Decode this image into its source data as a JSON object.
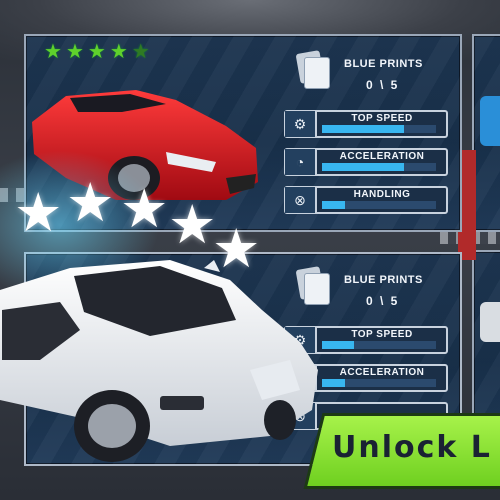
{
  "card_top": {
    "stars_filled": 4,
    "stars_total": 5,
    "blueprints_label": "BLUE PRINTS",
    "blueprints_count": "0 \\ 5",
    "stats": [
      {
        "label": "TOP SPEED",
        "icon": "gear-shift-icon",
        "level": 0.72
      },
      {
        "label": "ACCELERATION",
        "icon": "speedometer-icon",
        "level": 0.72
      },
      {
        "label": "HANDLING",
        "icon": "wheel-icon",
        "level": 0.2
      }
    ]
  },
  "card_bottom": {
    "stars_filled": 5,
    "stars_total": 5,
    "blueprints_label": "BLUE PRINTS",
    "blueprints_count": "0 \\ 5",
    "stats": [
      {
        "label": "TOP SPEED",
        "level": 0.28
      },
      {
        "label": "ACCELERATION",
        "level": 0.2
      }
    ]
  },
  "banner": {
    "text": "Unlock L"
  },
  "colors": {
    "star_green": "#5fd12c",
    "bar_blue": "#38b6f0",
    "banner_green": "#8fe234",
    "card_bg": "#1d3550"
  }
}
